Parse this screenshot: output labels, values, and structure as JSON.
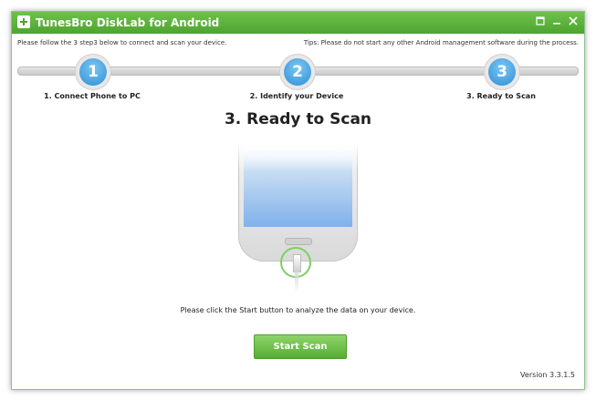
{
  "window": {
    "title": "TunesBro DiskLab for Android",
    "accent_color": "#5cb53c",
    "controls": [
      "maximize-icon",
      "minimize-icon",
      "close-icon"
    ]
  },
  "info": {
    "left": "Please follow the 3 step3 below to connect and scan your device.",
    "right": "Tips: Please do not start any other Android management software during the process."
  },
  "steps": [
    {
      "number": "1",
      "label": "1. Connect Phone to PC"
    },
    {
      "number": "2",
      "label": "2. Identify your Device"
    },
    {
      "number": "3",
      "label": "3. Ready to Scan"
    }
  ],
  "main": {
    "heading": "3. Ready to Scan",
    "instruction": "Please click the Start button to analyze the data on your device.",
    "start_button": "Start Scan"
  },
  "footer": {
    "version": "Version 3.3.1.5"
  }
}
